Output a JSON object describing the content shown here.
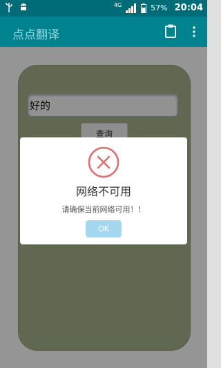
{
  "status_bar": {
    "network_type": "4G",
    "battery_percent": "57%",
    "time": "20:04"
  },
  "app_bar": {
    "title": "点点翻译",
    "actions": [
      "clipboard-icon",
      "more-vert-icon"
    ]
  },
  "main": {
    "input_value": "好的",
    "query_button_label": "查询"
  },
  "dialog": {
    "icon": "error-x-icon",
    "title": "网络不可用",
    "message": "请确保当前网络可用！！",
    "ok_label": "OK"
  },
  "colors": {
    "status_bar": "#006c78",
    "app_bar": "#00838f",
    "card": "#8e9a7a",
    "error_icon": "#e07070",
    "ok_button": "#a5d8f0"
  }
}
